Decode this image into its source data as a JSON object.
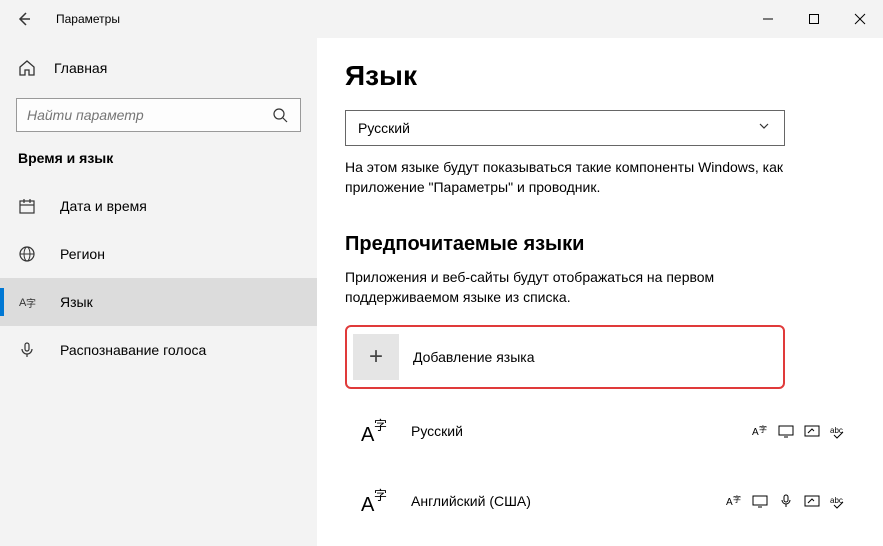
{
  "titlebar": {
    "title": "Параметры"
  },
  "sidebar": {
    "home": "Главная",
    "search_placeholder": "Найти параметр",
    "section": "Время и язык",
    "items": [
      {
        "label": "Дата и время"
      },
      {
        "label": "Регион"
      },
      {
        "label": "Язык"
      },
      {
        "label": "Распознавание голоса"
      }
    ]
  },
  "content": {
    "title": "Язык",
    "dropdown_value": "Русский",
    "dropdown_desc": "На этом языке будут показываться такие компоненты Windows, как приложение \"Параметры\" и проводник.",
    "preferred_header": "Предпочитаемые языки",
    "preferred_desc": "Приложения и веб-сайты будут отображаться на первом поддерживаемом языке из списка.",
    "add_lang_label": "Добавление языка",
    "langs": [
      {
        "name": "Русский"
      },
      {
        "name": "Английский (США)"
      }
    ]
  }
}
